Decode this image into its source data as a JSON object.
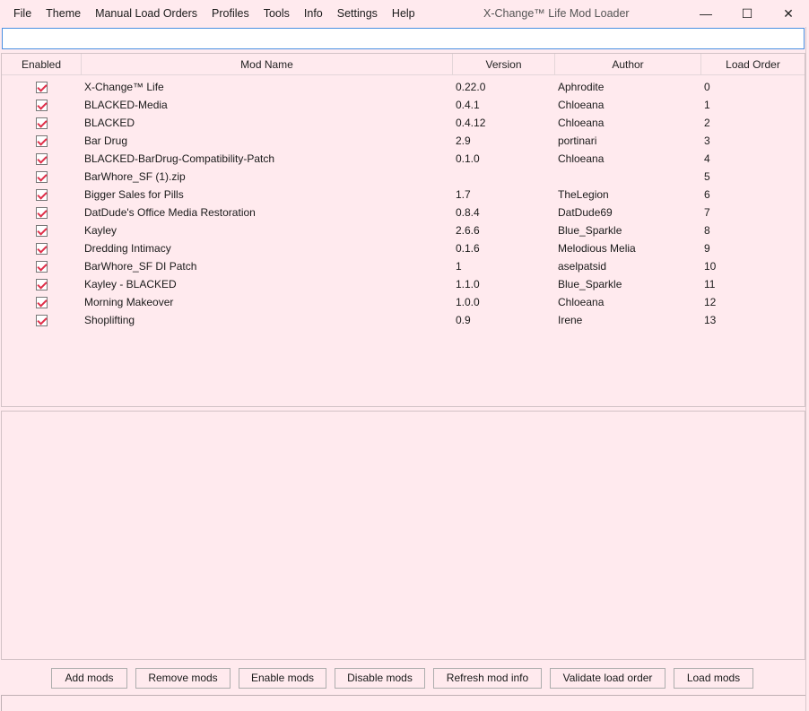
{
  "menu": [
    "File",
    "Theme",
    "Manual Load Orders",
    "Profiles",
    "Tools",
    "Info",
    "Settings",
    "Help"
  ],
  "window_title": "X-Change™ Life Mod Loader",
  "window_controls": {
    "minimize": "—",
    "maximize": "☐",
    "close": "✕"
  },
  "search": {
    "value": "",
    "placeholder": ""
  },
  "table": {
    "headers": [
      "Enabled",
      "Mod Name",
      "Version",
      "Author",
      "Load Order"
    ],
    "rows": [
      {
        "enabled": true,
        "name": "X-Change™ Life",
        "version": "0.22.0",
        "author": "Aphrodite",
        "order": "0"
      },
      {
        "enabled": true,
        "name": "BLACKED-Media",
        "version": "0.4.1",
        "author": "Chloeana",
        "order": "1"
      },
      {
        "enabled": true,
        "name": "BLACKED",
        "version": "0.4.12",
        "author": "Chloeana",
        "order": "2"
      },
      {
        "enabled": true,
        "name": "Bar Drug",
        "version": "2.9",
        "author": "portinari",
        "order": "3"
      },
      {
        "enabled": true,
        "name": "BLACKED-BarDrug-Compatibility-Patch",
        "version": "0.1.0",
        "author": "Chloeana",
        "order": "4"
      },
      {
        "enabled": true,
        "name": "BarWhore_SF (1).zip",
        "version": "",
        "author": "",
        "order": "5"
      },
      {
        "enabled": true,
        "name": "Bigger Sales for Pills",
        "version": "1.7",
        "author": "TheLegion",
        "order": "6"
      },
      {
        "enabled": true,
        "name": "DatDude's Office Media Restoration",
        "version": "0.8.4",
        "author": "DatDude69",
        "order": "7"
      },
      {
        "enabled": true,
        "name": "Kayley",
        "version": "2.6.6",
        "author": "Blue_Sparkle",
        "order": "8"
      },
      {
        "enabled": true,
        "name": "Dredding Intimacy",
        "version": "0.1.6",
        "author": "Melodious Melia",
        "order": "9"
      },
      {
        "enabled": true,
        "name": "BarWhore_SF DI Patch",
        "version": "1",
        "author": "aselpatsid",
        "order": "10"
      },
      {
        "enabled": true,
        "name": "Kayley - BLACKED",
        "version": "1.1.0",
        "author": "Blue_Sparkle",
        "order": "11"
      },
      {
        "enabled": true,
        "name": "Morning Makeover",
        "version": "1.0.0",
        "author": "Chloeana",
        "order": "12"
      },
      {
        "enabled": true,
        "name": "Shoplifting",
        "version": "0.9",
        "author": "Irene",
        "order": "13"
      }
    ]
  },
  "buttons": [
    "Add mods",
    "Remove mods",
    "Enable mods",
    "Disable mods",
    "Refresh mod info",
    "Validate load order",
    "Load mods"
  ],
  "colors": {
    "background": "#ffeaee",
    "check": "#e0304a",
    "search_border": "#4a90e2"
  }
}
